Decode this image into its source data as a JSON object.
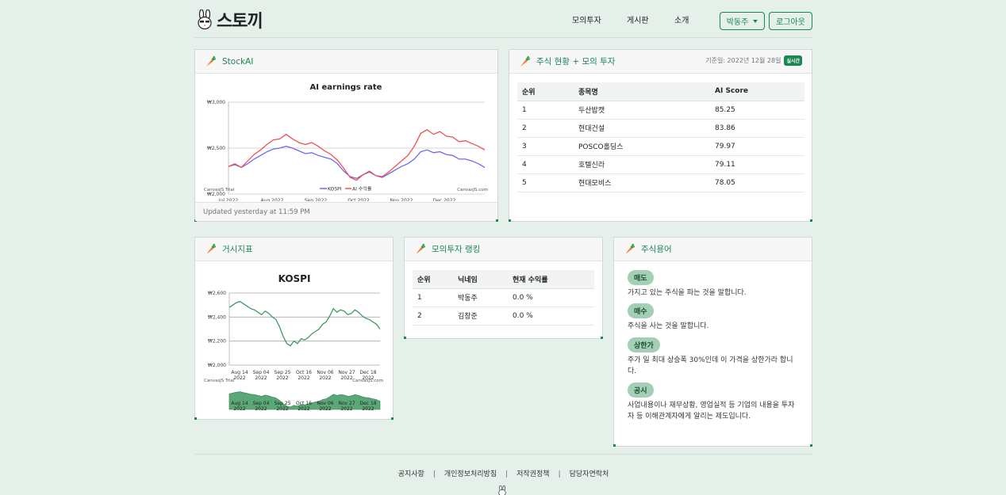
{
  "brand": {
    "name": "스토끼"
  },
  "nav": {
    "links": [
      "모의투자",
      "게시판",
      "소개"
    ],
    "user_label": "박동주",
    "logout_label": "로그아웃"
  },
  "stockai": {
    "title": "StockAI",
    "footer": "Updated yesterday at 11:59 PM",
    "chart_title": "AI earnings rate",
    "legend": [
      "KOSPI",
      "AI 수익률"
    ],
    "watermark_left": "CanvasJS Trial",
    "watermark_right": "CanvasJS.com"
  },
  "stocks": {
    "title": "주식 현황 + 모의 투자",
    "date": "기준일: 2022년 12월 28일",
    "badge": "실시간",
    "headers": [
      "순위",
      "종목명",
      "AI Score"
    ],
    "rows": [
      [
        "1",
        "두산밥캣",
        "85.25"
      ],
      [
        "2",
        "현대건설",
        "83.86"
      ],
      [
        "3",
        "POSCO홀딩스",
        "79.97"
      ],
      [
        "4",
        "호텔신라",
        "79.11"
      ],
      [
        "5",
        "현대모비스",
        "78.05"
      ]
    ]
  },
  "macro": {
    "title": "거시지표",
    "chart_title": "KOSPI",
    "watermark_left": "CanvasJS Trial",
    "watermark_right": "CanvasJS.com",
    "nav_labels": [
      "Aug 14",
      "Sep 04",
      "Sep 25",
      "Oct 16",
      "Nov 06",
      "Nov 27",
      "Dec 18"
    ],
    "nav_years": [
      "2022",
      "2022",
      "2022",
      "2022",
      "2022",
      "2022",
      "2022"
    ]
  },
  "ranking": {
    "title": "모의투자 랭킹",
    "headers": [
      "순위",
      "닉네임",
      "현재 수익률"
    ],
    "rows": [
      [
        "1",
        "박동주",
        "0.0 %"
      ],
      [
        "2",
        "김창준",
        "0.0 %"
      ]
    ]
  },
  "glossary": {
    "title": "주식용어",
    "terms": [
      {
        "term": "매도",
        "desc": "가지고 있는 주식을 파는 것을 말합니다."
      },
      {
        "term": "매수",
        "desc": "주식을 사는 것을 말합니다."
      },
      {
        "term": "상한가",
        "desc": "주가 일 최대 상승폭 30%인데 이 가격을 상한가라 합니다."
      },
      {
        "term": "공시",
        "desc": "사업내용이나 재무상황, 영업실적 등 기업의 내용을 투자자 등 이해관계자에게 알리는 제도입니다."
      }
    ]
  },
  "footer": {
    "links": [
      "공지사항",
      "개인정보처리방침",
      "저작권정책",
      "담당자연락처"
    ]
  },
  "colors": {
    "accent": "#198754",
    "kospi": "#6b6bf0",
    "ai": "#f05252",
    "macro": "#3f9a62"
  },
  "chart_data": [
    {
      "type": "line",
      "title": "AI earnings rate",
      "x": [
        "Jul 2022",
        "Aug 2022",
        "Sep 2022",
        "Oct 2022",
        "Nov 2022",
        "Dec 2022"
      ],
      "ylim": [
        2000,
        3000
      ],
      "yticks": [
        "₩2,000",
        "₩2,500",
        "₩3,000"
      ],
      "grid": true,
      "legend": "bottom",
      "series": [
        {
          "name": "KOSPI",
          "color": "#6b6bf0",
          "values": [
            2300,
            2320,
            2290,
            2330,
            2380,
            2420,
            2460,
            2490,
            2500,
            2520,
            2500,
            2470,
            2440,
            2450,
            2420,
            2400,
            2380,
            2330,
            2250,
            2190,
            2170,
            2210,
            2240,
            2200,
            2180,
            2220,
            2260,
            2300,
            2330,
            2380,
            2460,
            2480,
            2450,
            2460,
            2430,
            2420,
            2380,
            2380,
            2360,
            2330,
            2290
          ]
        },
        {
          "name": "AI 수익률",
          "color": "#f05252",
          "values": [
            2300,
            2330,
            2290,
            2360,
            2430,
            2480,
            2540,
            2590,
            2600,
            2650,
            2600,
            2560,
            2540,
            2560,
            2520,
            2470,
            2430,
            2370,
            2280,
            2180,
            2150,
            2210,
            2250,
            2200,
            2190,
            2240,
            2300,
            2360,
            2420,
            2520,
            2660,
            2700,
            2650,
            2680,
            2630,
            2620,
            2570,
            2580,
            2550,
            2520,
            2480
          ]
        }
      ]
    },
    {
      "type": "line",
      "title": "KOSPI",
      "x": [
        "Aug 14 2022",
        "Sep 04 2022",
        "Sep 25 2022",
        "Oct 16 2022",
        "Nov 06 2022",
        "Nov 27 2022",
        "Dec 18 2022"
      ],
      "ylim": [
        2000,
        2600
      ],
      "yticks": [
        "₩2,000",
        "₩2,200",
        "₩2,400",
        "₩2,600"
      ],
      "grid": true,
      "series": [
        {
          "name": "KOSPI",
          "color": "#3f9a62",
          "values": [
            2480,
            2500,
            2520,
            2530,
            2510,
            2490,
            2470,
            2460,
            2440,
            2420,
            2450,
            2430,
            2400,
            2380,
            2320,
            2240,
            2180,
            2160,
            2200,
            2180,
            2220,
            2210,
            2230,
            2260,
            2280,
            2300,
            2340,
            2360,
            2410,
            2470,
            2440,
            2460,
            2450,
            2420,
            2430,
            2460,
            2440,
            2410,
            2390,
            2380,
            2360,
            2340,
            2300
          ]
        }
      ]
    }
  ]
}
